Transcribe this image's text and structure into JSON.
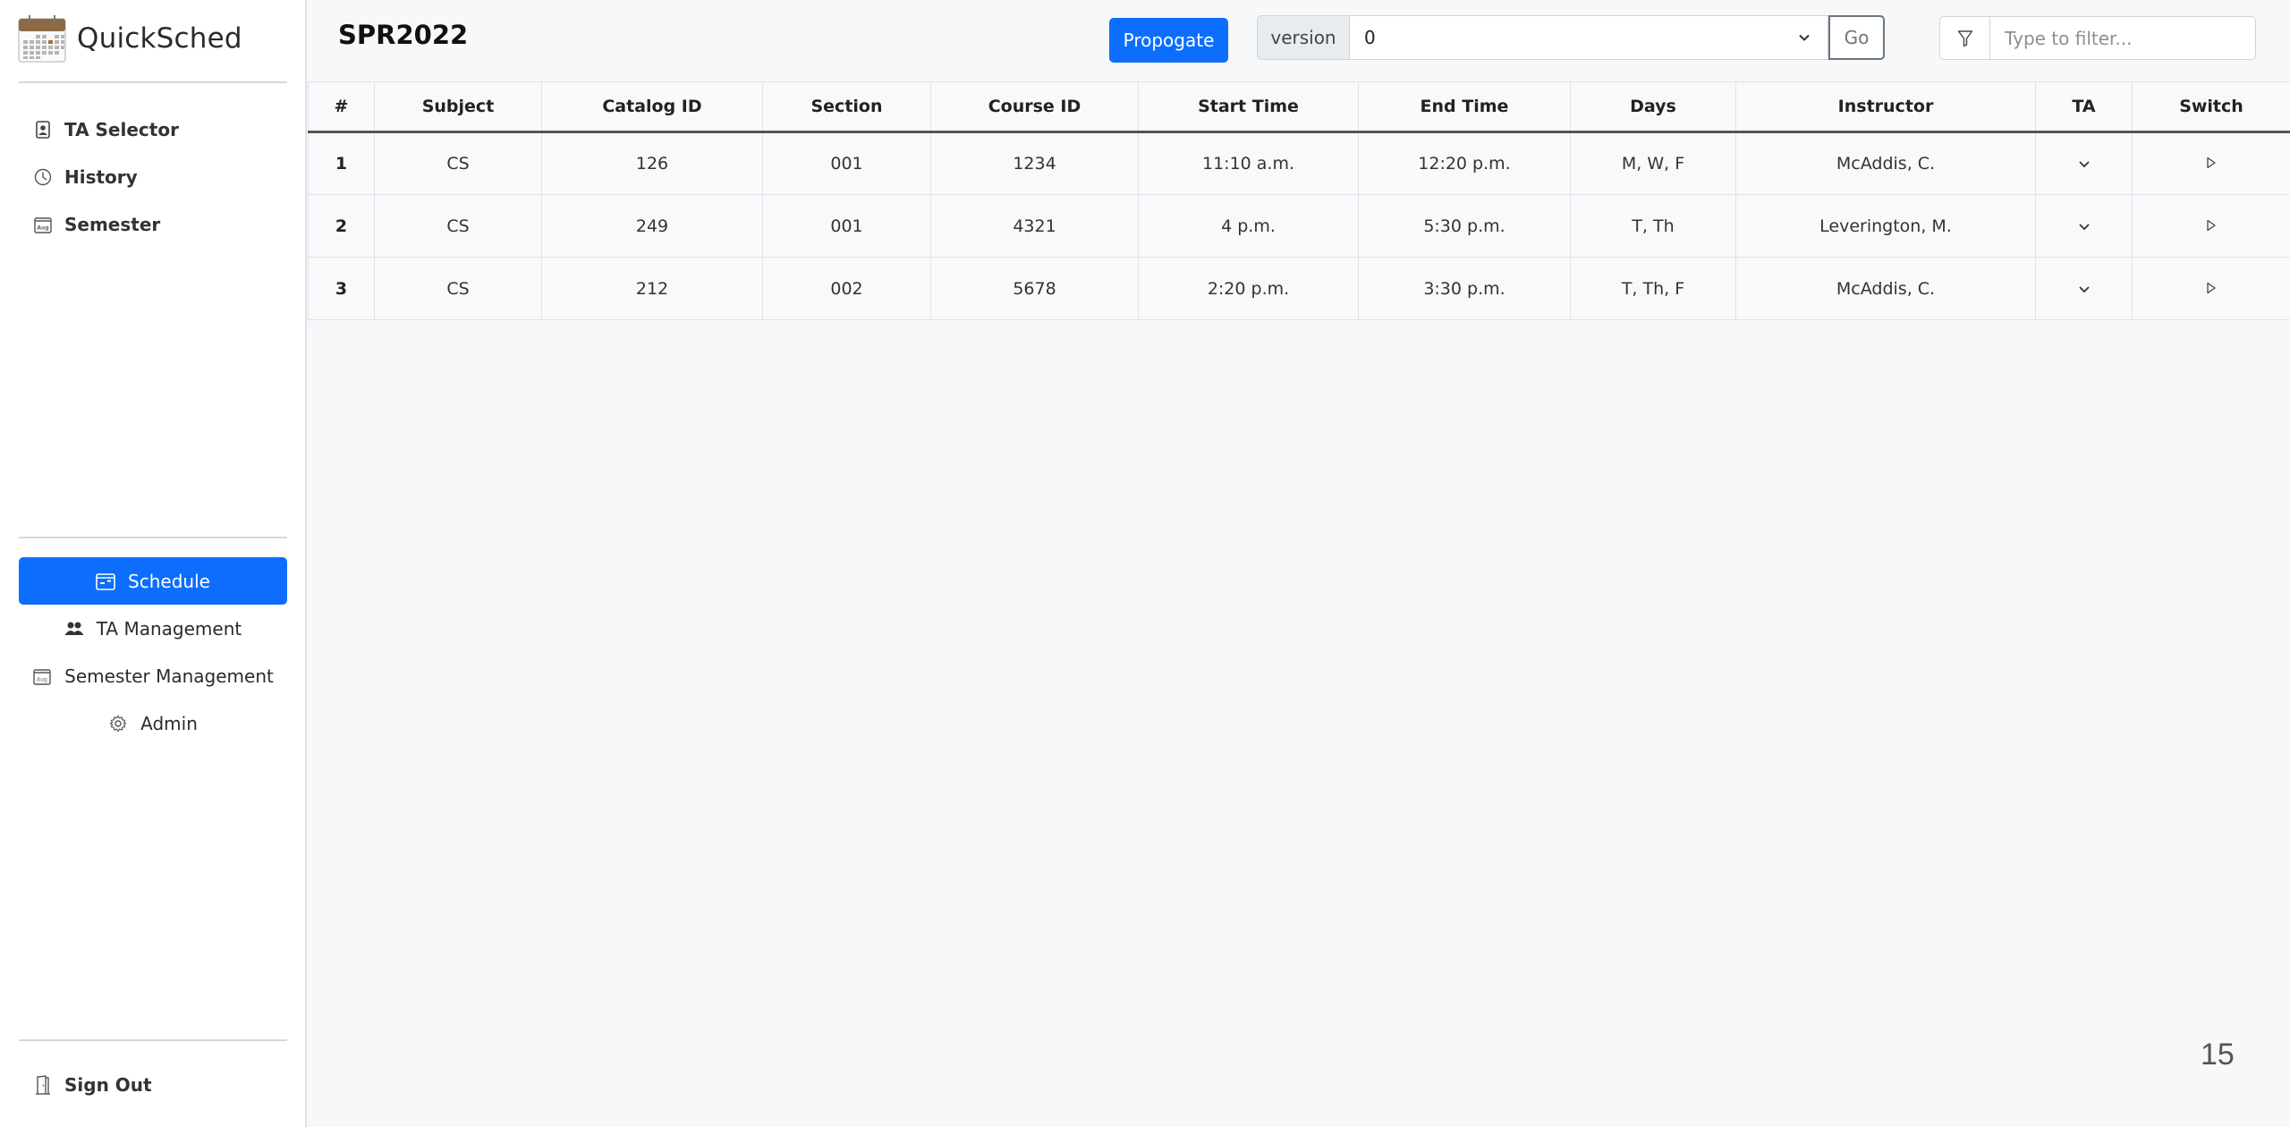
{
  "app": {
    "name": "QuickSched",
    "logo_icon": "calendar-logo-icon"
  },
  "sidebar": {
    "top_items": [
      {
        "label": "TA Selector",
        "icon": "person-badge-icon"
      },
      {
        "label": "History",
        "icon": "clock-icon"
      },
      {
        "label": "Semester",
        "icon": "calendar-aug-icon"
      }
    ],
    "mid_items": [
      {
        "label": "Schedule",
        "icon": "calendar-schedule-icon",
        "active": true
      },
      {
        "label": "TA Management",
        "icon": "people-icon",
        "active": false
      },
      {
        "label": "Semester Management",
        "icon": "calendar-aug-icon",
        "active": false
      },
      {
        "label": "Admin",
        "icon": "gear-icon",
        "active": false
      }
    ],
    "sign_out": {
      "label": "Sign Out",
      "icon": "door-icon"
    }
  },
  "header": {
    "title": "SPR2022",
    "propagate_label": "Propogate",
    "version_label": "version",
    "version_value": "0",
    "go_label": "Go",
    "filter_placeholder": "Type to filter...",
    "filter_value": ""
  },
  "colors": {
    "primary": "#0d6efd",
    "background": "#f7f8fa",
    "sidebar": "#ffffff"
  },
  "table": {
    "columns": [
      "#",
      "Subject",
      "Catalog ID",
      "Section",
      "Course ID",
      "Start Time",
      "End Time",
      "Days",
      "Instructor",
      "TA",
      "Switch"
    ],
    "rows": [
      {
        "num": "1",
        "subject": "CS",
        "catalog_id": "126",
        "section": "001",
        "course_id": "1234",
        "start": "11:10 a.m.",
        "end": "12:20 p.m.",
        "days": "M, W, F",
        "instructor": "McAddis, C."
      },
      {
        "num": "2",
        "subject": "CS",
        "catalog_id": "249",
        "section": "001",
        "course_id": "4321",
        "start": "4 p.m.",
        "end": "5:30 p.m.",
        "days": "T, Th",
        "instructor": "Leverington, M."
      },
      {
        "num": "3",
        "subject": "CS",
        "catalog_id": "212",
        "section": "002",
        "course_id": "5678",
        "start": "2:20 p.m.",
        "end": "3:30 p.m.",
        "days": "T, Th, F",
        "instructor": "McAddis, C."
      }
    ]
  },
  "footer": {
    "page_number": "15"
  }
}
